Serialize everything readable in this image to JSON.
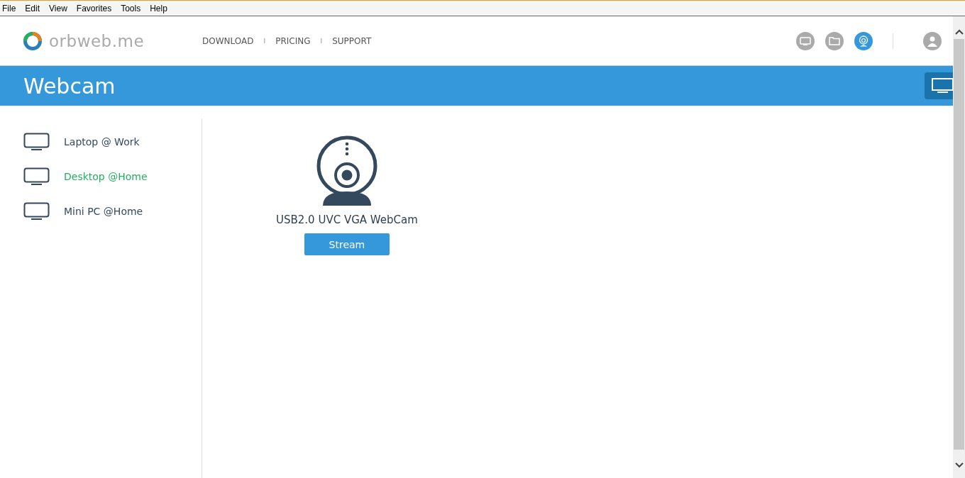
{
  "menu_bar": [
    "File",
    "Edit",
    "View",
    "Favorites",
    "Tools",
    "Help"
  ],
  "brand": {
    "name": "orbweb.me"
  },
  "nav_links": [
    "DOWNLOAD",
    "PRICING",
    "SUPPORT"
  ],
  "nav_separators": [
    "I",
    "I"
  ],
  "toolbar_icons": [
    {
      "kind": "screen",
      "selected": false
    },
    {
      "kind": "folder",
      "selected": false
    },
    {
      "kind": "webcam",
      "selected": true
    }
  ],
  "banner": {
    "title": "Webcam"
  },
  "devices": [
    {
      "name": "Laptop @ Work",
      "selected": false
    },
    {
      "name": "Desktop @Home",
      "selected": true
    },
    {
      "name": "Mini PC @Home",
      "selected": false
    }
  ],
  "cameras": [
    {
      "name": "USB2.0 UVC VGA WebCam",
      "button": "Stream"
    }
  ]
}
